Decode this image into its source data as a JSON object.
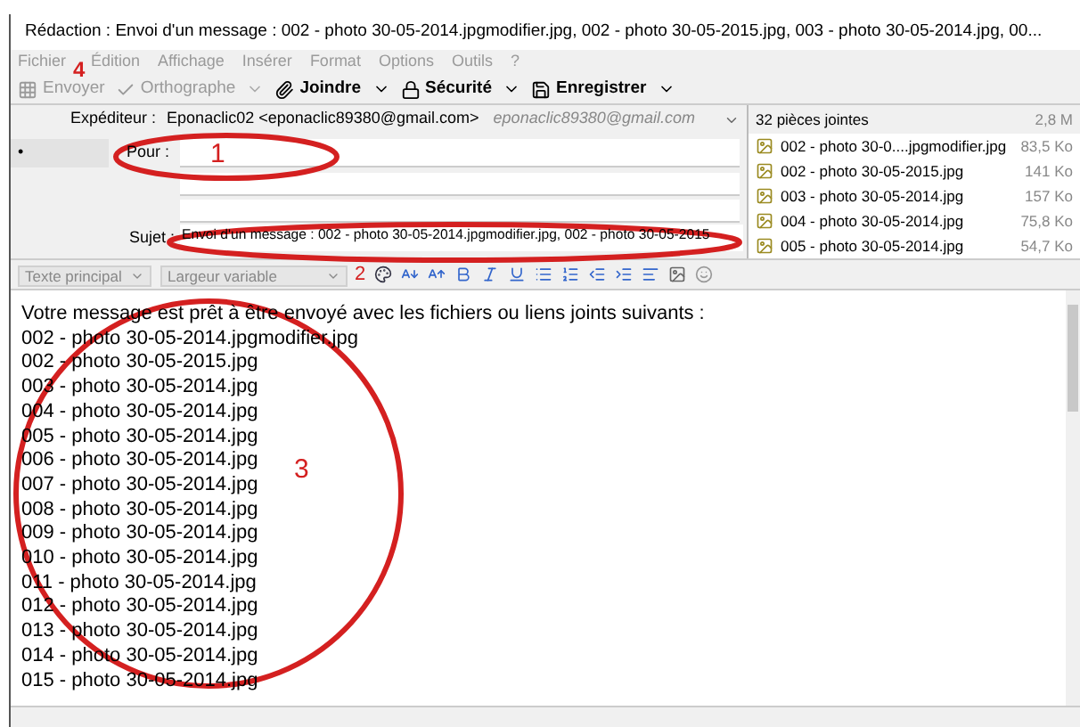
{
  "window": {
    "title": "Rédaction : Envoi d'un message : 002 - photo 30-05-2014.jpgmodifier.jpg, 002 - photo 30-05-2015.jpg, 003 - photo 30-05-2014.jpg, 00..."
  },
  "menu": [
    {
      "label": "Fichier",
      "disabled": true
    },
    {
      "label": "Édition",
      "disabled": true
    },
    {
      "label": "Affichage",
      "disabled": true
    },
    {
      "label": "Insérer",
      "disabled": true
    },
    {
      "label": "Format",
      "disabled": true
    },
    {
      "label": "Options",
      "disabled": true
    },
    {
      "label": "Outils",
      "disabled": true
    },
    {
      "label": "?",
      "disabled": true
    }
  ],
  "toolbar": [
    {
      "label": "Envoyer",
      "kind": "send",
      "disabled": true,
      "dropdown": false
    },
    {
      "label": "Orthographe",
      "kind": "spell",
      "disabled": true,
      "dropdown": true
    },
    {
      "label": "Joindre",
      "kind": "attach",
      "disabled": false,
      "dropdown": true
    },
    {
      "label": "Sécurité",
      "kind": "security",
      "disabled": false,
      "dropdown": true
    },
    {
      "label": "Enregistrer",
      "kind": "save",
      "disabled": false,
      "dropdown": true
    }
  ],
  "header": {
    "sender_label": "Expéditeur :",
    "sender_value": "Eponaclic02 <eponaclic89380@gmail.com>",
    "sender_hint": "eponaclic89380@gmail.com",
    "recipient_type": "•",
    "to_label": "Pour :",
    "subject_label": "Sujet :",
    "subject_value": "Envoi d'un message : 002 - photo 30-05-2014.jpgmodifier.jpg, 002 - photo 30-05-2015"
  },
  "attachments": {
    "title": "32 pièces jointes",
    "total": "2,8 M",
    "items": [
      {
        "name": "002 - photo 30-0....jpgmodifier.jpg",
        "size": "83,5 Ko"
      },
      {
        "name": "002 - photo 30-05-2015.jpg",
        "size": "141 Ko"
      },
      {
        "name": "003 - photo 30-05-2014.jpg",
        "size": "157 Ko"
      },
      {
        "name": "004 - photo 30-05-2014.jpg",
        "size": "75,8 Ko"
      },
      {
        "name": "005 - photo 30-05-2014.jpg",
        "size": "54,7 Ko"
      }
    ]
  },
  "format_bar": {
    "paragraph_style": "Texte principal",
    "font": "Largeur variable"
  },
  "body": {
    "intro": "Votre message est prêt à être envoyé avec les fichiers ou liens joints suivants :",
    "lines": [
      "002 - photo 30-05-2014.jpgmodifier.jpg",
      "002 - photo 30-05-2015.jpg",
      "003 - photo 30-05-2014.jpg",
      "004 - photo 30-05-2014.jpg",
      "005 - photo 30-05-2014.jpg",
      "006 - photo 30-05-2014.jpg",
      "007 - photo 30-05-2014.jpg",
      "008 - photo 30-05-2014.jpg",
      "009 - photo 30-05-2014.jpg",
      "010 - photo 30-05-2014.jpg",
      "011 - photo 30-05-2014.jpg",
      "012 - photo 30-05-2014.jpg",
      "013 - photo 30-05-2014.jpg",
      "014 - photo 30-05-2014.jpg",
      "015 - photo 30-05-2014.jpg"
    ]
  },
  "annotations": [
    {
      "number": "1",
      "circled": true
    },
    {
      "number": "2",
      "circled": true
    },
    {
      "number": "3",
      "circled": true
    },
    {
      "number": "4",
      "circled": false
    }
  ]
}
